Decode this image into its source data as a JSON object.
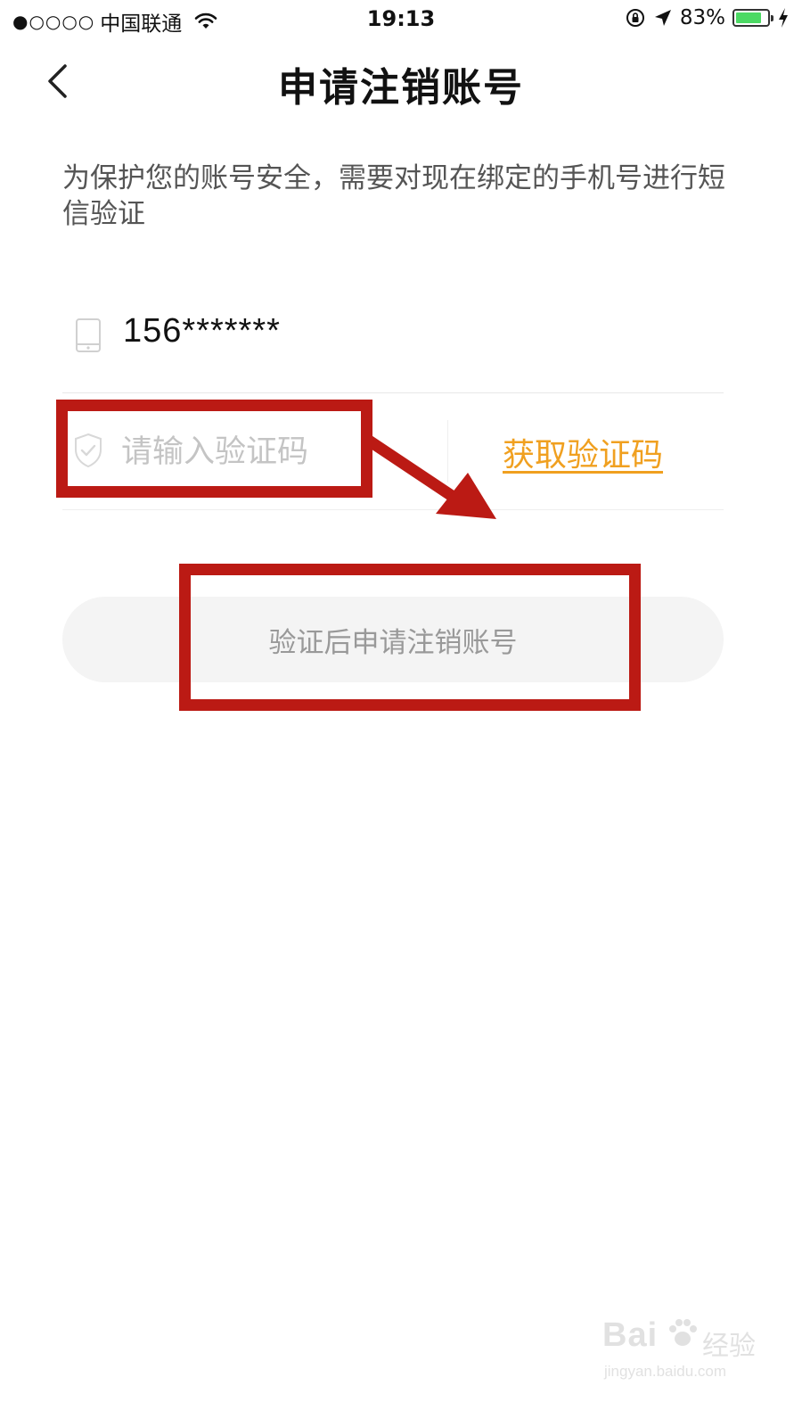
{
  "status_bar": {
    "signal_dots": "●○○○○",
    "carrier": "中国联通",
    "time": "19:13",
    "battery_percent": "83%",
    "battery_level": 0.83
  },
  "nav": {
    "title": "申请注销账号"
  },
  "description": "为保护您的账号安全，需要对现在绑定的手机号进行短信验证",
  "phone": {
    "number": "156*******"
  },
  "code": {
    "placeholder": "请输入验证码",
    "get_code_label": "获取验证码"
  },
  "submit": {
    "label": "验证后申请注销账号"
  },
  "watermark": {
    "brand": "Bai",
    "brand_cn": "经验",
    "url": "jingyan.baidu.com"
  },
  "colors": {
    "accent": "#f0a020",
    "annotation_red": "#bb1a14",
    "button_bg": "#f4f4f4",
    "battery_green": "#4cd964"
  }
}
